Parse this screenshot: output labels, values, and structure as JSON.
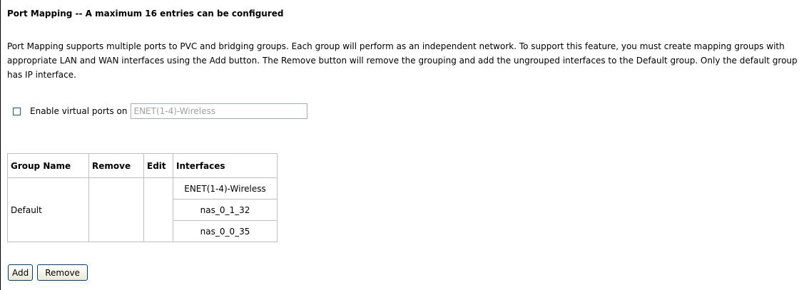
{
  "page": {
    "title": "Port Mapping -- A maximum 16 entries can be configured",
    "description": "Port Mapping supports multiple ports to PVC and bridging groups. Each group will perform as an independent network. To support this feature, you must create mapping groups with appropriate LAN and WAN interfaces using the Add button. The Remove button will remove the grouping and add the ungrouped interfaces to the Default group. Only the default group has IP interface."
  },
  "virtual_ports": {
    "checkbox_label": "Enable virtual ports on",
    "checked": false,
    "input_value": "ENET(1-4)-Wireless"
  },
  "table": {
    "headers": {
      "group_name": "Group Name",
      "remove": "Remove",
      "edit": "Edit",
      "interfaces": "Interfaces"
    },
    "rows": [
      {
        "group_name": "Default",
        "interfaces": [
          "ENET(1-4)-Wireless",
          "nas_0_1_32",
          "nas_0_0_35"
        ]
      }
    ]
  },
  "buttons": {
    "add": "Add",
    "remove": "Remove"
  }
}
